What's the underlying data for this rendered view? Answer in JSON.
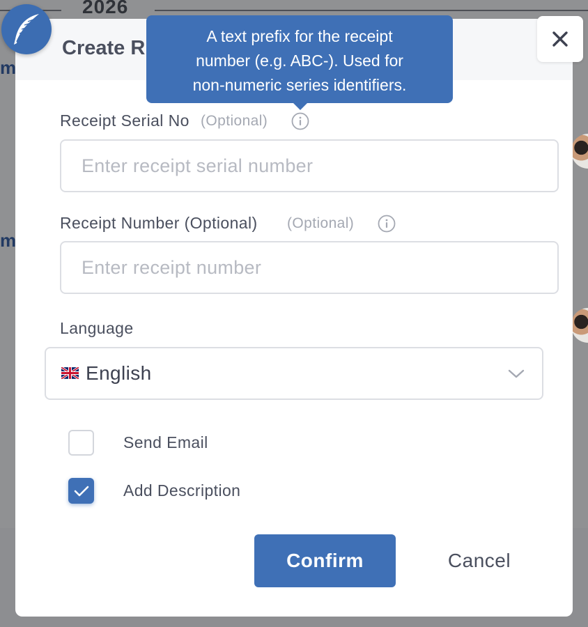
{
  "backdrop": {
    "year": "2026",
    "clipped_text_1": "m",
    "clipped_text_2": "m"
  },
  "modal": {
    "title": "Create R",
    "close_icon": "close-icon",
    "logo_icon": "feather-icon"
  },
  "tooltip": {
    "lines": [
      "A text prefix for the receipt",
      "number (e.g. ABC-). Used for",
      "non-numeric series identifiers."
    ]
  },
  "form": {
    "serial": {
      "label": "Receipt Serial No",
      "optional": "(Optional)",
      "placeholder": "Enter receipt serial number",
      "value": "",
      "info_icon": "info-icon"
    },
    "number": {
      "label": "Receipt Number (Optional)",
      "optional": "(Optional)",
      "placeholder": "Enter receipt number",
      "value": "",
      "info_icon": "info-icon"
    },
    "language": {
      "label": "Language",
      "selected": "English",
      "flag_icon": "uk-flag-icon",
      "chevron_icon": "chevron-down-icon"
    },
    "send_email": {
      "label": "Send Email",
      "checked": false
    },
    "add_description": {
      "label": "Add Description",
      "checked": true
    }
  },
  "actions": {
    "confirm_label": "Confirm",
    "cancel_label": "Cancel"
  },
  "colors": {
    "accent": "#3f70b6",
    "overlay": "#8a8a8d",
    "text": "#4a4f5e",
    "placeholder": "#b7bac2"
  }
}
